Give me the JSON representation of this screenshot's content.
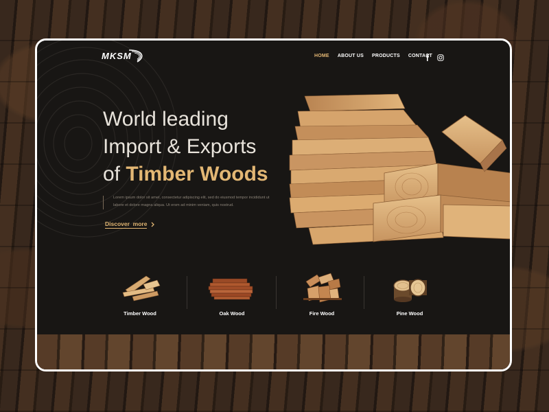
{
  "brand": {
    "logo_text": "MKSM"
  },
  "nav": {
    "items": [
      {
        "label": "HOME",
        "active": true
      },
      {
        "label": "ABOUT US",
        "active": false
      },
      {
        "label": "PRODUCTS",
        "active": false
      },
      {
        "label": "CONTACT",
        "active": false
      }
    ],
    "social": [
      "facebook-icon",
      "instagram-icon"
    ]
  },
  "hero": {
    "line1": "World leading",
    "line2": "Import & Exports",
    "line3_prefix": "of ",
    "line3_highlight": "Timber Woods",
    "description_line1": "Lorem ipsum dolor sit amet, consectetur adipiscing elit, sed do eiusmod tempor incididunt ut",
    "description_line2": "labore et dolore magna aliqua. Ut ersm ad minim veniam, quis nostrud.",
    "cta": "Discover  more"
  },
  "categories": [
    {
      "label": "Timber Wood",
      "icon": "timber-wood-icon"
    },
    {
      "label": "Oak Wood",
      "icon": "oak-wood-icon"
    },
    {
      "label": "Fire Wood",
      "icon": "fire-wood-icon"
    },
    {
      "label": "Pine Wood",
      "icon": "pine-wood-icon"
    }
  ],
  "colors": {
    "accent": "#e3b774",
    "background": "#181614",
    "text": "#e8e3db",
    "frame": "#ffffff"
  }
}
